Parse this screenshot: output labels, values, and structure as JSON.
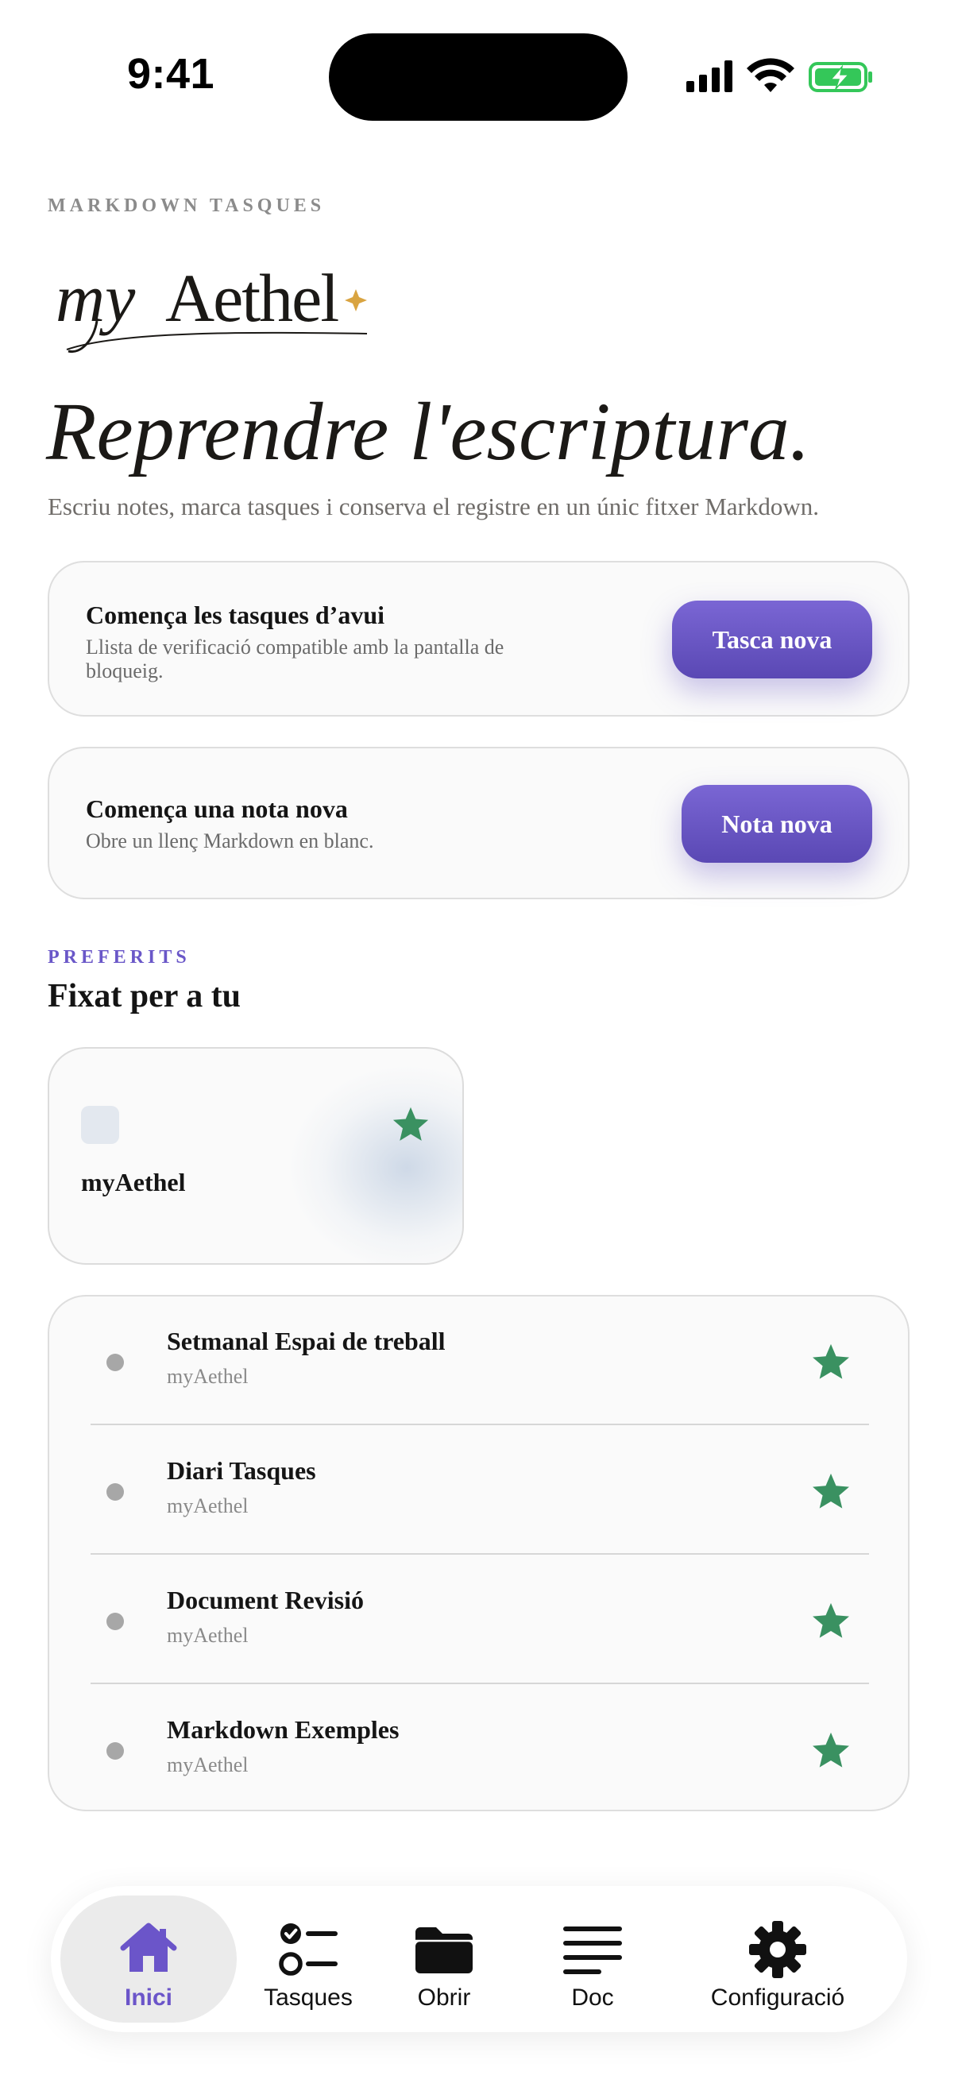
{
  "status_bar": {
    "time": "9:41"
  },
  "header": {
    "eyebrow": "MARKDOWN TASQUES",
    "logo_text": "myAethel",
    "headline": "Reprendre l'escriptura.",
    "subtitle": "Escriu notes, marca tasques i conserva el registre en un únic fitxer Markdown."
  },
  "actions": {
    "tasks": {
      "title": "Comença les tasques d’avui",
      "description": "Llista de verificació compatible amb la pantalla de bloqueig.",
      "button": "Tasca nova"
    },
    "note": {
      "title": "Comença una nota nova",
      "description": "Obre un llenç Markdown en blanc.",
      "button": "Nota nova"
    }
  },
  "favorites": {
    "eyebrow": "PREFERITS",
    "title": "Fixat per a tu",
    "tile_name": "myAethel",
    "items": [
      {
        "title": "Setmanal Espai de treball",
        "subtitle": "myAethel"
      },
      {
        "title": "Diari Tasques",
        "subtitle": "myAethel"
      },
      {
        "title": "Document Revisió",
        "subtitle": "myAethel"
      },
      {
        "title": "Markdown Exemples",
        "subtitle": "myAethel"
      }
    ]
  },
  "tabbar": {
    "tabs": [
      {
        "label": "Inici",
        "icon": "home-icon",
        "active": true
      },
      {
        "label": "Tasques",
        "icon": "checklist-icon",
        "active": false
      },
      {
        "label": "Obrir",
        "icon": "folder-icon",
        "active": false
      },
      {
        "label": "Doc",
        "icon": "lines-icon",
        "active": false
      },
      {
        "label": "Configuració",
        "icon": "gear-icon",
        "active": false
      }
    ]
  },
  "colors": {
    "accent": "#6b55c9",
    "star": "#3a9161",
    "logo_sparkle": "#d9a441",
    "battery": "#34c759"
  }
}
